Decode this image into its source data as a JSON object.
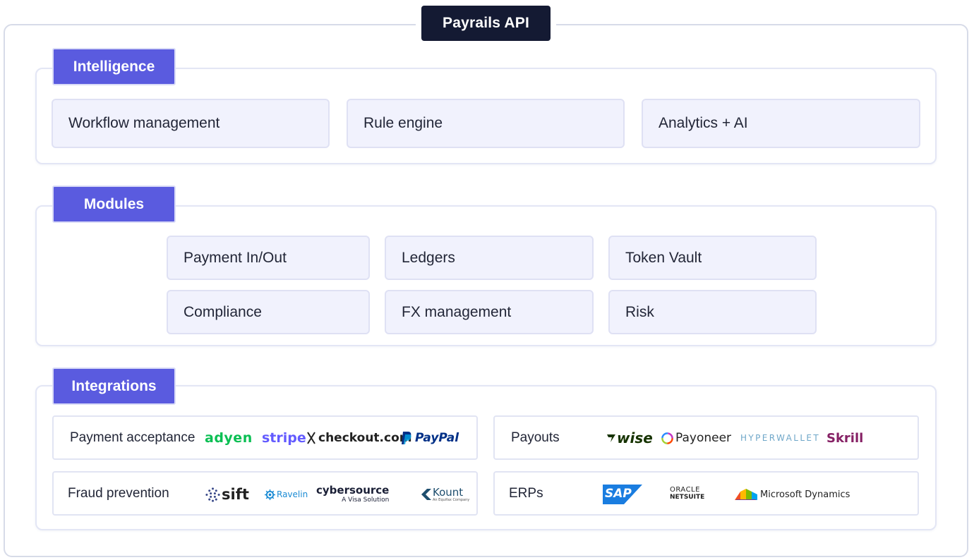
{
  "title": "Payrails API",
  "intelligence": {
    "label": "Intelligence",
    "items": [
      "Workflow management",
      "Rule engine",
      "Analytics + AI"
    ]
  },
  "modules": {
    "label": "Modules",
    "items": [
      "Payment In/Out",
      "Ledgers",
      "Token Vault",
      "Compliance",
      "FX management",
      "Risk"
    ]
  },
  "integrations": {
    "label": "Integrations",
    "payment_acceptance": {
      "label": "Payment acceptance",
      "logos": [
        "adyen",
        "stripe",
        "checkout.com",
        "PayPal"
      ]
    },
    "payouts": {
      "label": "Payouts",
      "logos": [
        "wise",
        "Payoneer",
        "HYPERWALLET",
        "Skrill"
      ]
    },
    "fraud_prevention": {
      "label": "Fraud prevention",
      "logos": [
        "sift",
        "Ravelin",
        "cybersource",
        "A Visa Solution",
        "Kount",
        "An Equifax Company"
      ]
    },
    "erps": {
      "label": "ERPs",
      "logos": [
        "SAP",
        "ORACLE",
        "NETSUITE",
        "Microsoft Dynamics"
      ]
    }
  },
  "colors": {
    "title_bg": "#141a33",
    "section_label_bg": "#5a5bdf",
    "card_bg": "#f1f2fd",
    "adyen": "#0abf53",
    "stripe": "#635bff",
    "paypal_dark": "#003087",
    "paypal_light": "#009cde",
    "wise": "#163300",
    "skrill": "#862165",
    "ravelin": "#1b8bd4"
  }
}
